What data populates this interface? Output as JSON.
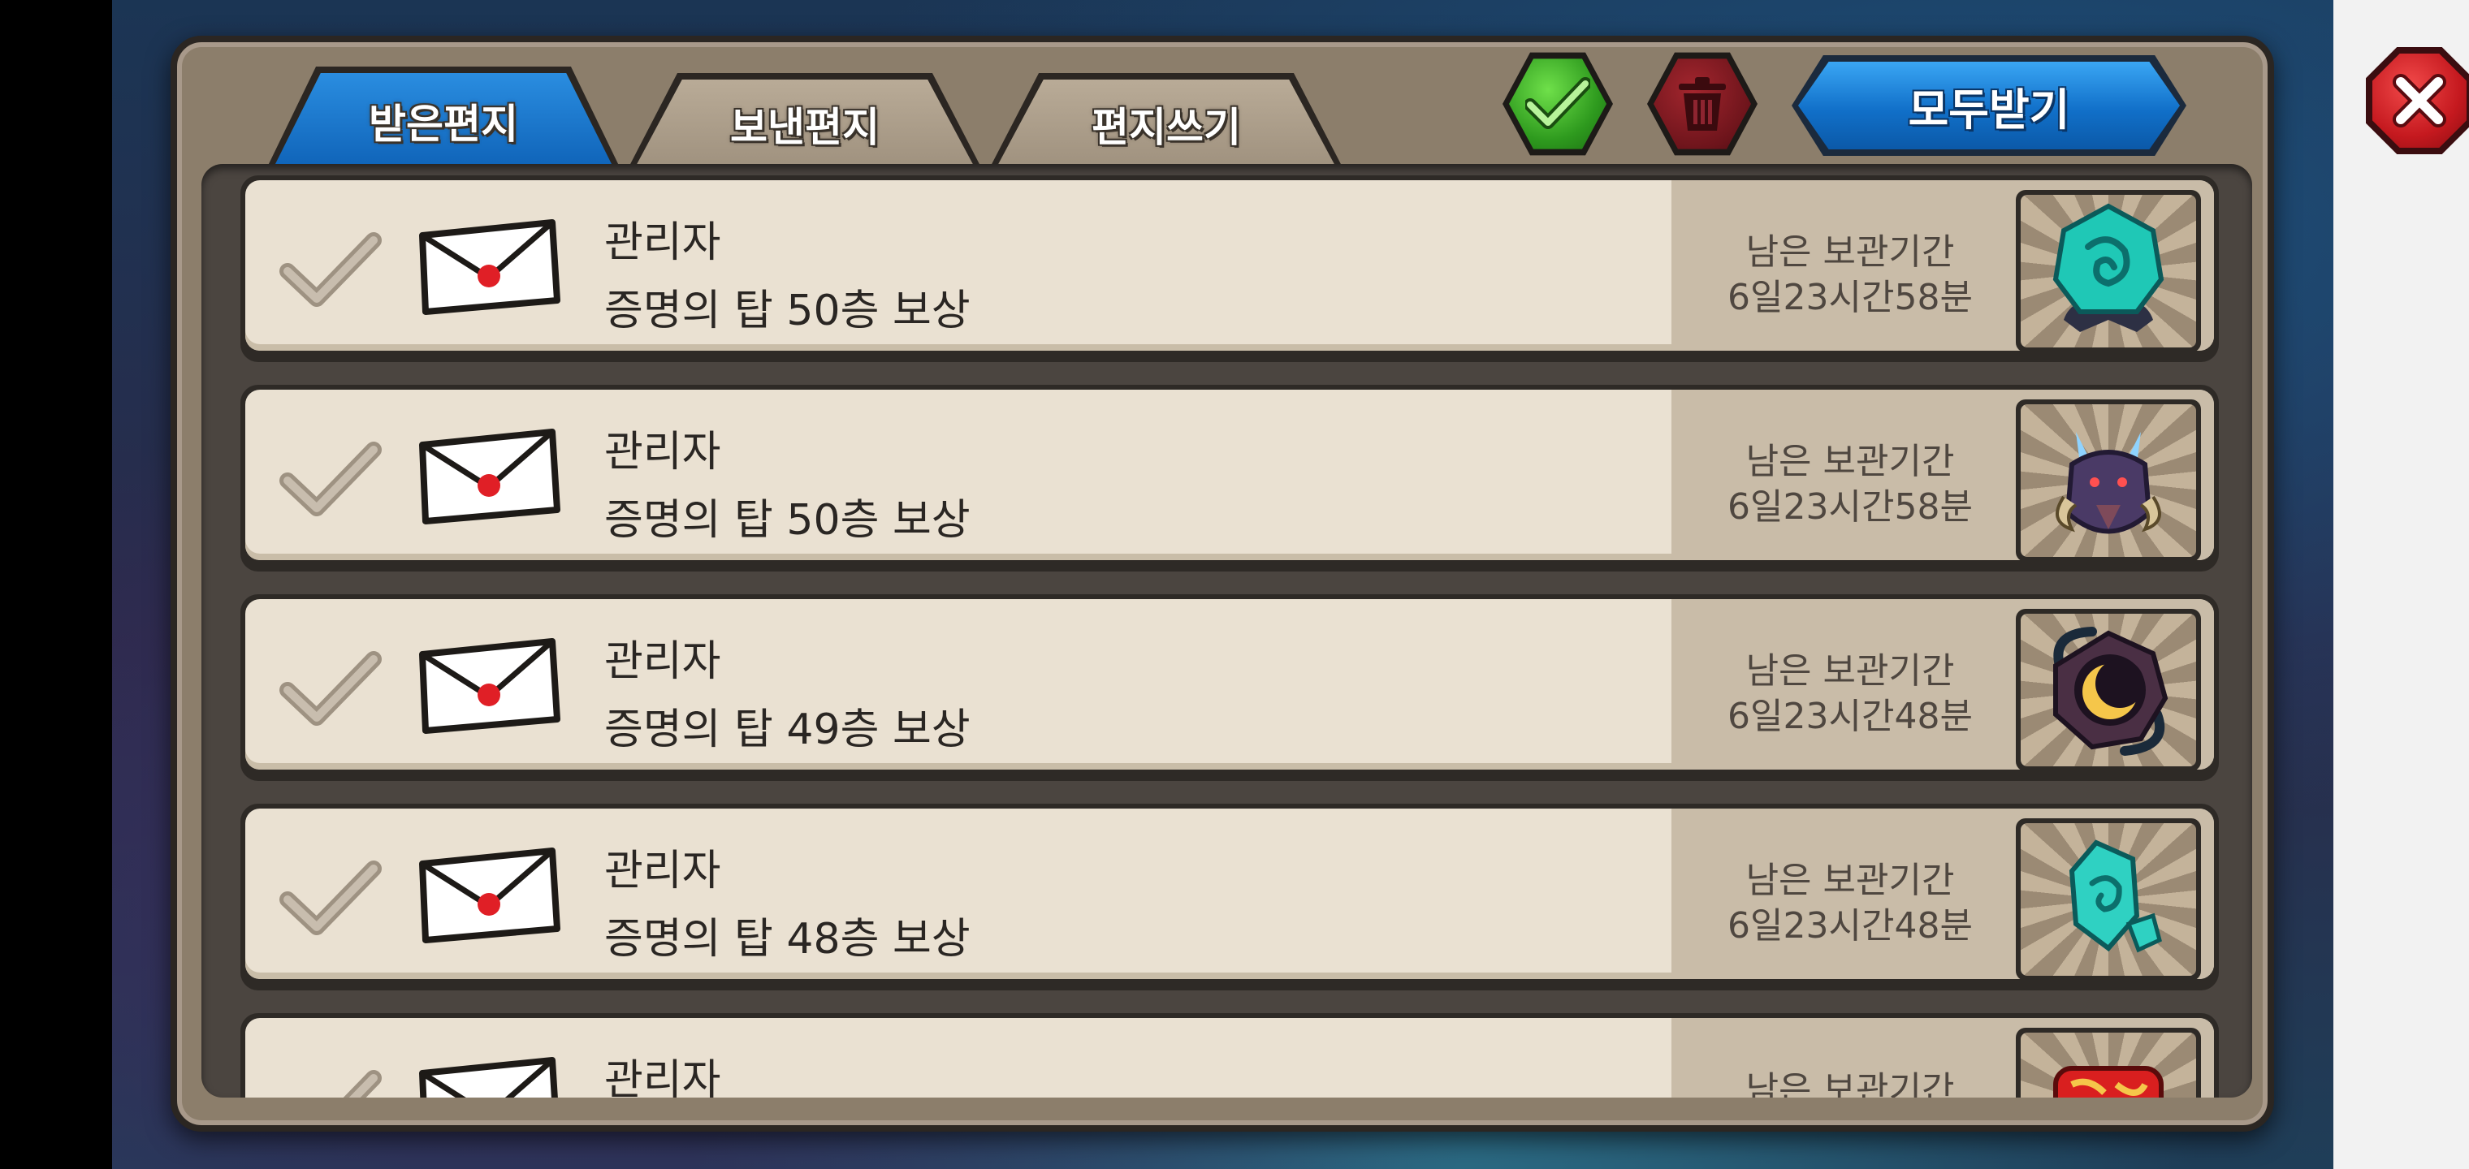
{
  "tabs": [
    {
      "label": "받은편지",
      "active": true
    },
    {
      "label": "보낸편지",
      "active": false
    },
    {
      "label": "편지쓰기",
      "active": false
    }
  ],
  "header": {
    "receive_all_label": "모두받기",
    "select_all_icon": "checkmark-icon",
    "delete_icon": "trash-icon",
    "close_icon": "close-icon"
  },
  "mails": [
    {
      "sender": "관리자",
      "subject": "증명의 탑 50층 보상",
      "expire_label": "남은 보관기간",
      "expire_time": "6일23시간58분",
      "reward_icon": "cyan-gem-egg-icon"
    },
    {
      "sender": "관리자",
      "subject": "증명의 탑 50층 보상",
      "expire_label": "남은 보관기간",
      "expire_time": "6일23시간58분",
      "reward_icon": "dragon-head-icon"
    },
    {
      "sender": "관리자",
      "subject": "증명의 탑 49층 보상",
      "expire_label": "남은 보관기간",
      "expire_time": "6일23시간48분",
      "reward_icon": "moon-stone-icon"
    },
    {
      "sender": "관리자",
      "subject": "증명의 탑 48층 보상",
      "expire_label": "남은 보관기간",
      "expire_time": "6일23시간48분",
      "reward_icon": "cyan-gem-icon"
    },
    {
      "sender": "관리자",
      "subject": "",
      "expire_label": "남은 보관기간",
      "expire_time": "",
      "reward_icon": "red-scroll-icon"
    }
  ],
  "colors": {
    "tab_active": "#1875cc",
    "tab_inactive": "#a89a86",
    "confirm_green": "#3bb227",
    "delete_red": "#7a1620",
    "receive_all_blue": "#1a82dd",
    "close_red": "#d11d24"
  }
}
